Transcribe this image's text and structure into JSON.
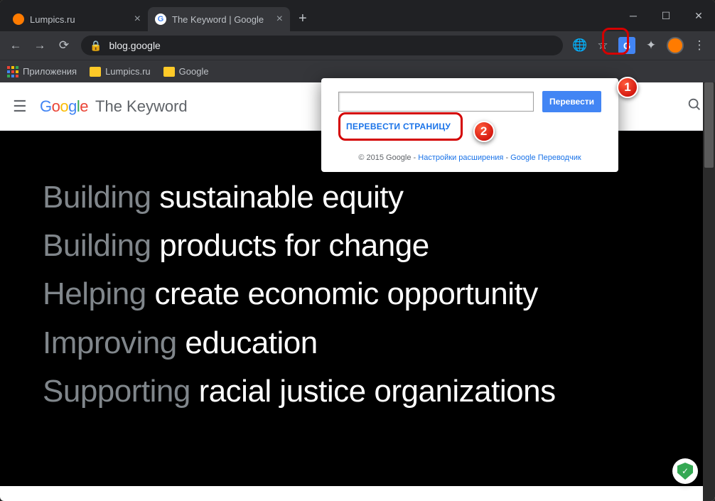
{
  "tabs": [
    {
      "title": "Lumpics.ru",
      "active": false
    },
    {
      "title": "The Keyword | Google",
      "active": true
    }
  ],
  "address": {
    "url": "blog.google"
  },
  "bookmarks": {
    "apps": "Приложения",
    "items": [
      "Lumpics.ru",
      "Google"
    ]
  },
  "page": {
    "logo_brand": "Google",
    "title": "The Keyword",
    "hero": [
      {
        "muted": "Building ",
        "white": "sustainable equity"
      },
      {
        "muted": "Building ",
        "white": "products for change"
      },
      {
        "muted": "Helping ",
        "white": "create economic opportunity"
      },
      {
        "muted": "Improving ",
        "white": "education"
      },
      {
        "muted": "Supporting ",
        "white": "racial justice organizations"
      }
    ]
  },
  "ext": {
    "translate_btn": "Перевести",
    "translate_page": "ПЕРЕВЕСТИ СТРАНИЦУ",
    "footer_copyright": "© 2015 Google",
    "footer_sep": " - ",
    "footer_link1": "Настройки расширения",
    "footer_link2": "Google Переводчик"
  },
  "annotations": {
    "badge1": "1",
    "badge2": "2"
  }
}
